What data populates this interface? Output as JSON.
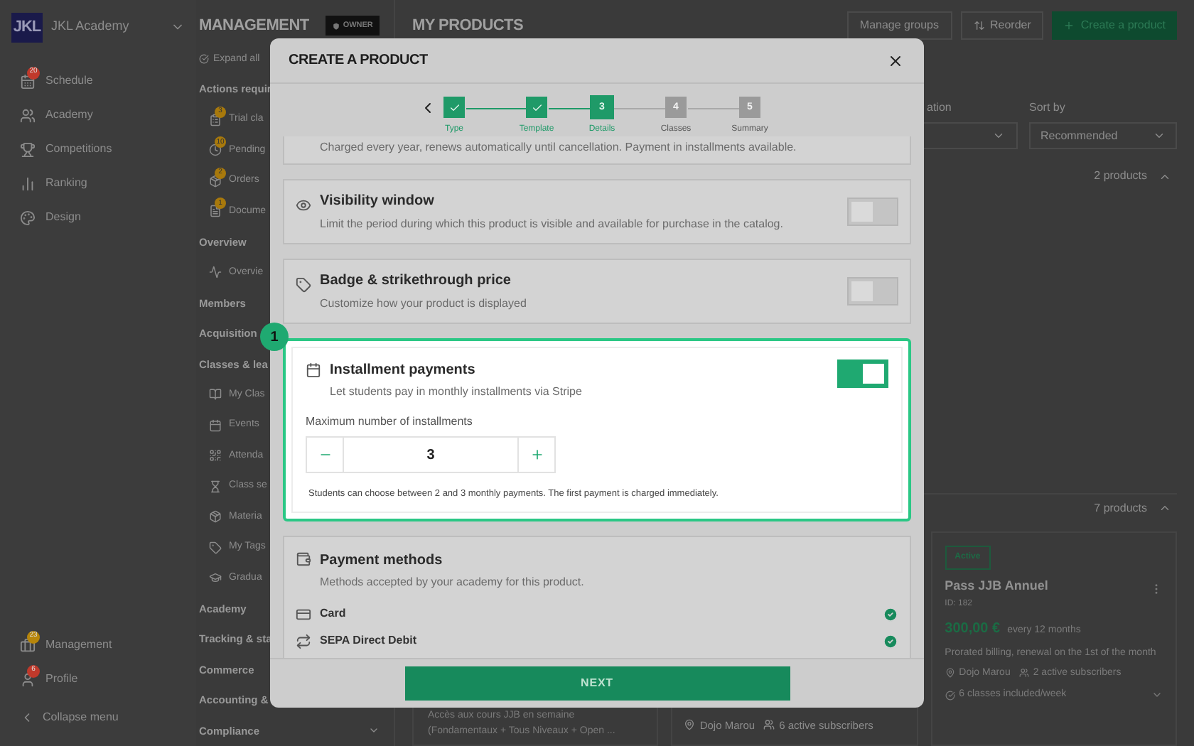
{
  "sidebar": {
    "logo": "JKL",
    "academy": "JKL Academy",
    "items": [
      {
        "label": "Schedule",
        "badge": "20",
        "color": "#c0392b"
      },
      {
        "label": "Academy"
      },
      {
        "label": "Competitions"
      },
      {
        "label": "Ranking"
      },
      {
        "label": "Design"
      }
    ],
    "bottom_items": [
      {
        "label": "Management",
        "badge": "23",
        "color": "#b7860b"
      },
      {
        "label": "Profile",
        "badge": "6",
        "color": "#c0392b"
      }
    ],
    "collapse": "Collapse menu"
  },
  "section_nav": {
    "title": "MANAGEMENT",
    "role": "OWNER",
    "expand_all": "Expand all",
    "groups": [
      {
        "label": "Actions requir",
        "children": [
          {
            "label": "Trial cla",
            "badge": "3"
          },
          {
            "label": "Pending",
            "badge": "10"
          },
          {
            "label": "Orders",
            "badge": "2"
          },
          {
            "label": "Docume",
            "badge": "1"
          }
        ]
      },
      {
        "label": "Overview",
        "children": [
          {
            "label": "Overvie"
          }
        ]
      },
      {
        "label": "Members"
      },
      {
        "label": "Acquisition"
      },
      {
        "label": "Classes & lea",
        "children": [
          {
            "label": "My Clas"
          },
          {
            "label": "Events"
          },
          {
            "label": "Attenda"
          },
          {
            "label": "Class se"
          },
          {
            "label": "Materia"
          },
          {
            "label": "My Tags"
          },
          {
            "label": "Gradua"
          }
        ]
      },
      {
        "label": "Academy"
      },
      {
        "label": "Tracking & sta"
      },
      {
        "label": "Commerce"
      },
      {
        "label": "Accounting & "
      },
      {
        "label": "Compliance"
      }
    ]
  },
  "page": {
    "title": "MY PRODUCTS",
    "actions": [
      {
        "label": "Manage groups",
        "kind": "plain"
      },
      {
        "label": "Reorder",
        "kind": "reorder"
      },
      {
        "label": "Create a product",
        "kind": "primary"
      }
    ],
    "filter_label": "ation",
    "sort": {
      "label": "Sort by",
      "value": "Recommended"
    },
    "groups": [
      {
        "count": "2 products",
        "expanded": true
      },
      {
        "count": "7 products",
        "expanded": true
      }
    ],
    "cards": [
      {
        "kind": "description",
        "text": "Accès aux cours JJB en semaine (Fondamentaux + Tous Niveaux + Open ..."
      },
      {
        "kind": "meta",
        "location": "Dojo Marou",
        "subscribers": "6 active subscribers"
      },
      {
        "kind": "full",
        "status": "Active",
        "title": "Pass JJB Annuel",
        "id": "ID: 182",
        "price": "300,00 €",
        "period": "every 12 months",
        "note": "Prorated billing, renewal on the 1st of the month",
        "location": "Dojo Marou",
        "subscribers": "2 active subscribers",
        "classes": "6 classes included/week"
      }
    ]
  },
  "modal": {
    "title": "CREATE A PRODUCT",
    "steps": [
      {
        "label": "Type",
        "completed": true,
        "selected": false
      },
      {
        "label": "Template",
        "completed": true,
        "selected": false
      },
      {
        "label": "Details",
        "number": "3",
        "completed": false,
        "selected": true
      },
      {
        "label": "Classes",
        "number": "4",
        "completed": false,
        "selected": false
      },
      {
        "label": "Summary",
        "number": "5",
        "completed": false,
        "selected": false
      }
    ],
    "sections": [
      {
        "kind": "partial",
        "description": "Charged every year, renews automatically until cancellation. Payment in installments available."
      },
      {
        "kind": "toggle",
        "title": "Visibility window",
        "description": "Limit the period during which this product is visible and available for purchase in the catalog.",
        "on": false
      },
      {
        "kind": "toggle",
        "title": "Badge & strikethrough price",
        "description": "Customize how your product is displayed",
        "on": false
      },
      {
        "kind": "installments",
        "highlight": "1",
        "title": "Installment payments",
        "description": "Let students pay in monthly installments via Stripe",
        "on": true,
        "field_label": "Maximum number of installments",
        "value": "3",
        "note": "Students can choose between 2 and 3 monthly payments. The first payment is charged immediately."
      },
      {
        "kind": "methods",
        "title": "Payment methods",
        "description": "Methods accepted by your academy for this product.",
        "methods": [
          {
            "label": "Card",
            "enabled": true
          },
          {
            "label": "SEPA Direct Debit",
            "enabled": true
          }
        ]
      }
    ],
    "next": "NEXT"
  }
}
